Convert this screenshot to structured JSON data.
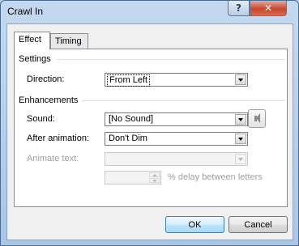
{
  "window": {
    "title": "Crawl In",
    "help_glyph": "?",
    "close_glyph": "✕"
  },
  "tabs": [
    {
      "label": "Effect",
      "active": true
    },
    {
      "label": "Timing",
      "active": false
    }
  ],
  "settings": {
    "group_title": "Settings",
    "direction_label": "Direction:",
    "direction_value": "From Left"
  },
  "enhancements": {
    "group_title": "Enhancements",
    "sound_label": "Sound:",
    "sound_value": "[No Sound]",
    "after_animation_label": "After animation:",
    "after_animation_value": "Don't Dim",
    "animate_text_label": "Animate text:",
    "animate_text_value": "",
    "delay_value": "",
    "delay_label": "% delay between letters"
  },
  "buttons": {
    "ok": "OK",
    "cancel": "Cancel"
  },
  "icons": {
    "help": "help-icon",
    "close": "close-icon",
    "sound": "speaker-icon",
    "dropdown": "chevron-down-icon"
  }
}
